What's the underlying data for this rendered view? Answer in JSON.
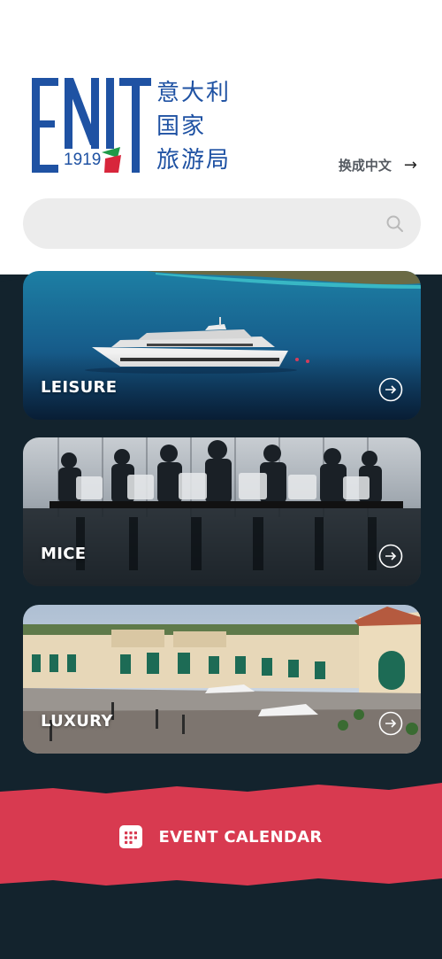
{
  "logo": {
    "letters": "ENIT",
    "year": "1919",
    "cn_lines": [
      "意大利",
      "国家",
      "旅游局"
    ]
  },
  "language_switch": {
    "label": "换成中文",
    "arrow": "→"
  },
  "search": {
    "placeholder": "",
    "icon": "search-icon"
  },
  "cards": [
    {
      "label": "LEISURE",
      "icon": "arrow-right-circle-icon"
    },
    {
      "label": "MICE",
      "icon": "arrow-right-circle-icon"
    },
    {
      "label": "LUXURY",
      "icon": "arrow-right-circle-icon"
    }
  ],
  "event": {
    "label": "EVENT CALENDAR",
    "icon": "calendar-grid-icon"
  },
  "colors": {
    "brand_blue": "#1f52a3",
    "dark_bg": "#13232d",
    "event_red": "#d83a50",
    "flag_green": "#1f9a48",
    "flag_red": "#d8263b"
  }
}
